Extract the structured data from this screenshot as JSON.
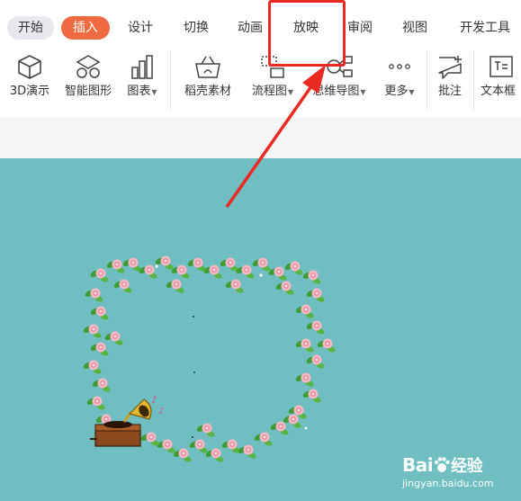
{
  "tabs": {
    "home": "开始",
    "insert": "插入",
    "design": "设计",
    "transition": "切换",
    "animation": "动画",
    "slideshow": "放映",
    "review": "审阅",
    "view": "视图",
    "developer": "开发工具"
  },
  "ribbon": {
    "model3d": "3D演示",
    "smartart": "智能图形",
    "chart": "图表",
    "material": "稻壳素材",
    "flowchart": "流程图",
    "mindmap": "思维导图",
    "more": "更多",
    "comment": "批注",
    "textbox": "文本框"
  },
  "watermark": {
    "logo_left": "Bai",
    "logo_right": "经验",
    "url": "jingyan.baidu.com"
  },
  "colors": {
    "accent": "#f06a41",
    "canvas": "#6fbfc2",
    "annotation": "#ea2a22"
  },
  "icons": [
    "cube-icon",
    "smartart-icon",
    "bar-chart-icon",
    "basket-icon",
    "flowchart-icon",
    "mindmap-icon",
    "more-dots-icon",
    "comment-icon",
    "textbox-icon",
    "gramophone-icon"
  ]
}
